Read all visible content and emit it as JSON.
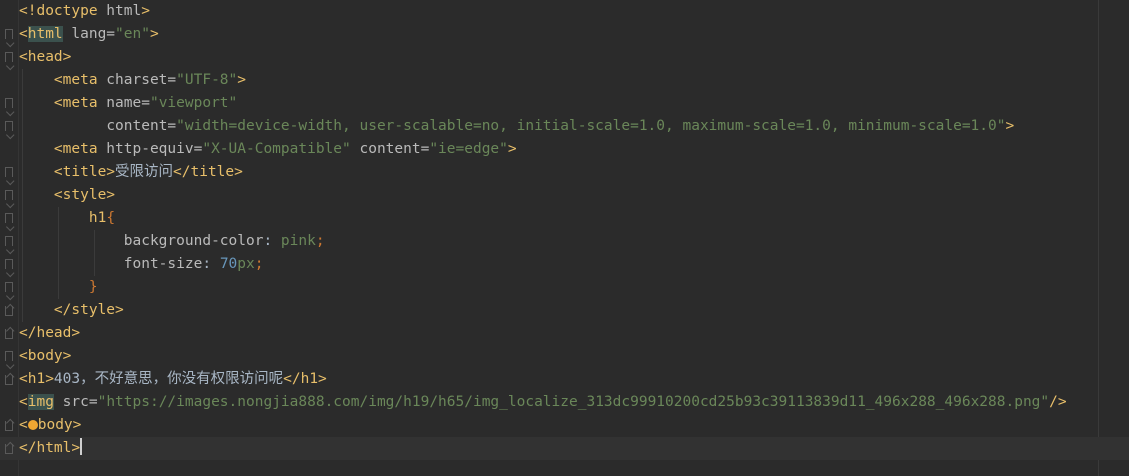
{
  "lines": [
    {
      "segments": [
        {
          "c": "t",
          "x": "<!doctype"
        },
        {
          "c": "a",
          "x": " html"
        },
        {
          "c": "t",
          "x": ">"
        }
      ]
    },
    {
      "segments": [
        {
          "c": "t",
          "x": "<"
        },
        {
          "c": "hl",
          "x": "html"
        },
        {
          "c": "a",
          "x": " lang="
        },
        {
          "c": "v",
          "x": "\"en\""
        },
        {
          "c": "t",
          "x": ">"
        }
      ]
    },
    {
      "segments": [
        {
          "c": "t",
          "x": "<head>"
        }
      ]
    },
    {
      "segments": [
        {
          "c": "p",
          "x": "    "
        },
        {
          "c": "t",
          "x": "<meta"
        },
        {
          "c": "a",
          "x": " charset="
        },
        {
          "c": "v",
          "x": "\"UTF-8\""
        },
        {
          "c": "t",
          "x": ">"
        }
      ]
    },
    {
      "segments": [
        {
          "c": "p",
          "x": "    "
        },
        {
          "c": "t",
          "x": "<meta"
        },
        {
          "c": "a",
          "x": " name="
        },
        {
          "c": "v",
          "x": "\"viewport\""
        }
      ]
    },
    {
      "segments": [
        {
          "c": "p",
          "x": "          "
        },
        {
          "c": "a",
          "x": "content="
        },
        {
          "c": "v",
          "x": "\"width=device-width, user-scalable=no, initial-scale=1.0, maximum-scale=1.0, minimum-scale=1.0\""
        },
        {
          "c": "t",
          "x": ">"
        }
      ]
    },
    {
      "segments": [
        {
          "c": "p",
          "x": "    "
        },
        {
          "c": "t",
          "x": "<meta"
        },
        {
          "c": "a",
          "x": " http-equiv="
        },
        {
          "c": "v",
          "x": "\"X-UA-Compatible\""
        },
        {
          "c": "a",
          "x": " content="
        },
        {
          "c": "v",
          "x": "\"ie=edge\""
        },
        {
          "c": "t",
          "x": ">"
        }
      ]
    },
    {
      "segments": [
        {
          "c": "p",
          "x": "    "
        },
        {
          "c": "t",
          "x": "<title>"
        },
        {
          "c": "p",
          "x": "受限访问"
        },
        {
          "c": "t",
          "x": "</title>"
        }
      ]
    },
    {
      "segments": [
        {
          "c": "p",
          "x": "    "
        },
        {
          "c": "t",
          "x": "<style>"
        }
      ]
    },
    {
      "segments": [
        {
          "c": "p",
          "x": "        "
        },
        {
          "c": "t",
          "x": "h1"
        },
        {
          "c": "k",
          "x": "{"
        }
      ]
    },
    {
      "segments": [
        {
          "c": "p",
          "x": "            "
        },
        {
          "c": "s",
          "x": "background-color"
        },
        {
          "c": "p",
          "x": ": "
        },
        {
          "c": "v",
          "x": "pink"
        },
        {
          "c": "k",
          "x": ";"
        }
      ]
    },
    {
      "segments": [
        {
          "c": "p",
          "x": "            "
        },
        {
          "c": "s",
          "x": "font-size"
        },
        {
          "c": "p",
          "x": ": "
        },
        {
          "c": "n",
          "x": "70"
        },
        {
          "c": "v",
          "x": "px"
        },
        {
          "c": "k",
          "x": ";"
        }
      ]
    },
    {
      "segments": [
        {
          "c": "p",
          "x": "        "
        },
        {
          "c": "k",
          "x": "}"
        }
      ]
    },
    {
      "segments": [
        {
          "c": "p",
          "x": "    "
        },
        {
          "c": "t",
          "x": "</style>"
        }
      ]
    },
    {
      "segments": [
        {
          "c": "t",
          "x": "</head>"
        }
      ]
    },
    {
      "segments": [
        {
          "c": "t",
          "x": "<body>"
        }
      ]
    },
    {
      "segments": [
        {
          "c": "t",
          "x": "<h1>"
        },
        {
          "c": "p",
          "x": "403，不好意思，你没有权限访问呢"
        },
        {
          "c": "t",
          "x": "</h1>"
        }
      ]
    },
    {
      "segments": [
        {
          "c": "t",
          "x": "<"
        },
        {
          "c": "hl",
          "x": "img"
        },
        {
          "c": "a",
          "x": " src="
        },
        {
          "c": "v",
          "x": "\"https://images.nongjia888.com/img/h19/h65/img_localize_313dc99910200cd25b93c39113839d11_496x288_496x288.png\""
        },
        {
          "c": "t",
          "x": "/>"
        }
      ]
    },
    {
      "segments": [
        {
          "c": "t",
          "x": "<"
        },
        {
          "c": "bulb",
          "x": ""
        },
        {
          "c": "t",
          "x": "body>"
        }
      ]
    },
    {
      "segments": [
        {
          "c": "t",
          "x": "</html>"
        },
        {
          "c": "cursor",
          "x": ""
        }
      ]
    }
  ],
  "folds": [
    1,
    2,
    4,
    5,
    7,
    8,
    9,
    10,
    11,
    12,
    13,
    14,
    15,
    16,
    18,
    19
  ]
}
